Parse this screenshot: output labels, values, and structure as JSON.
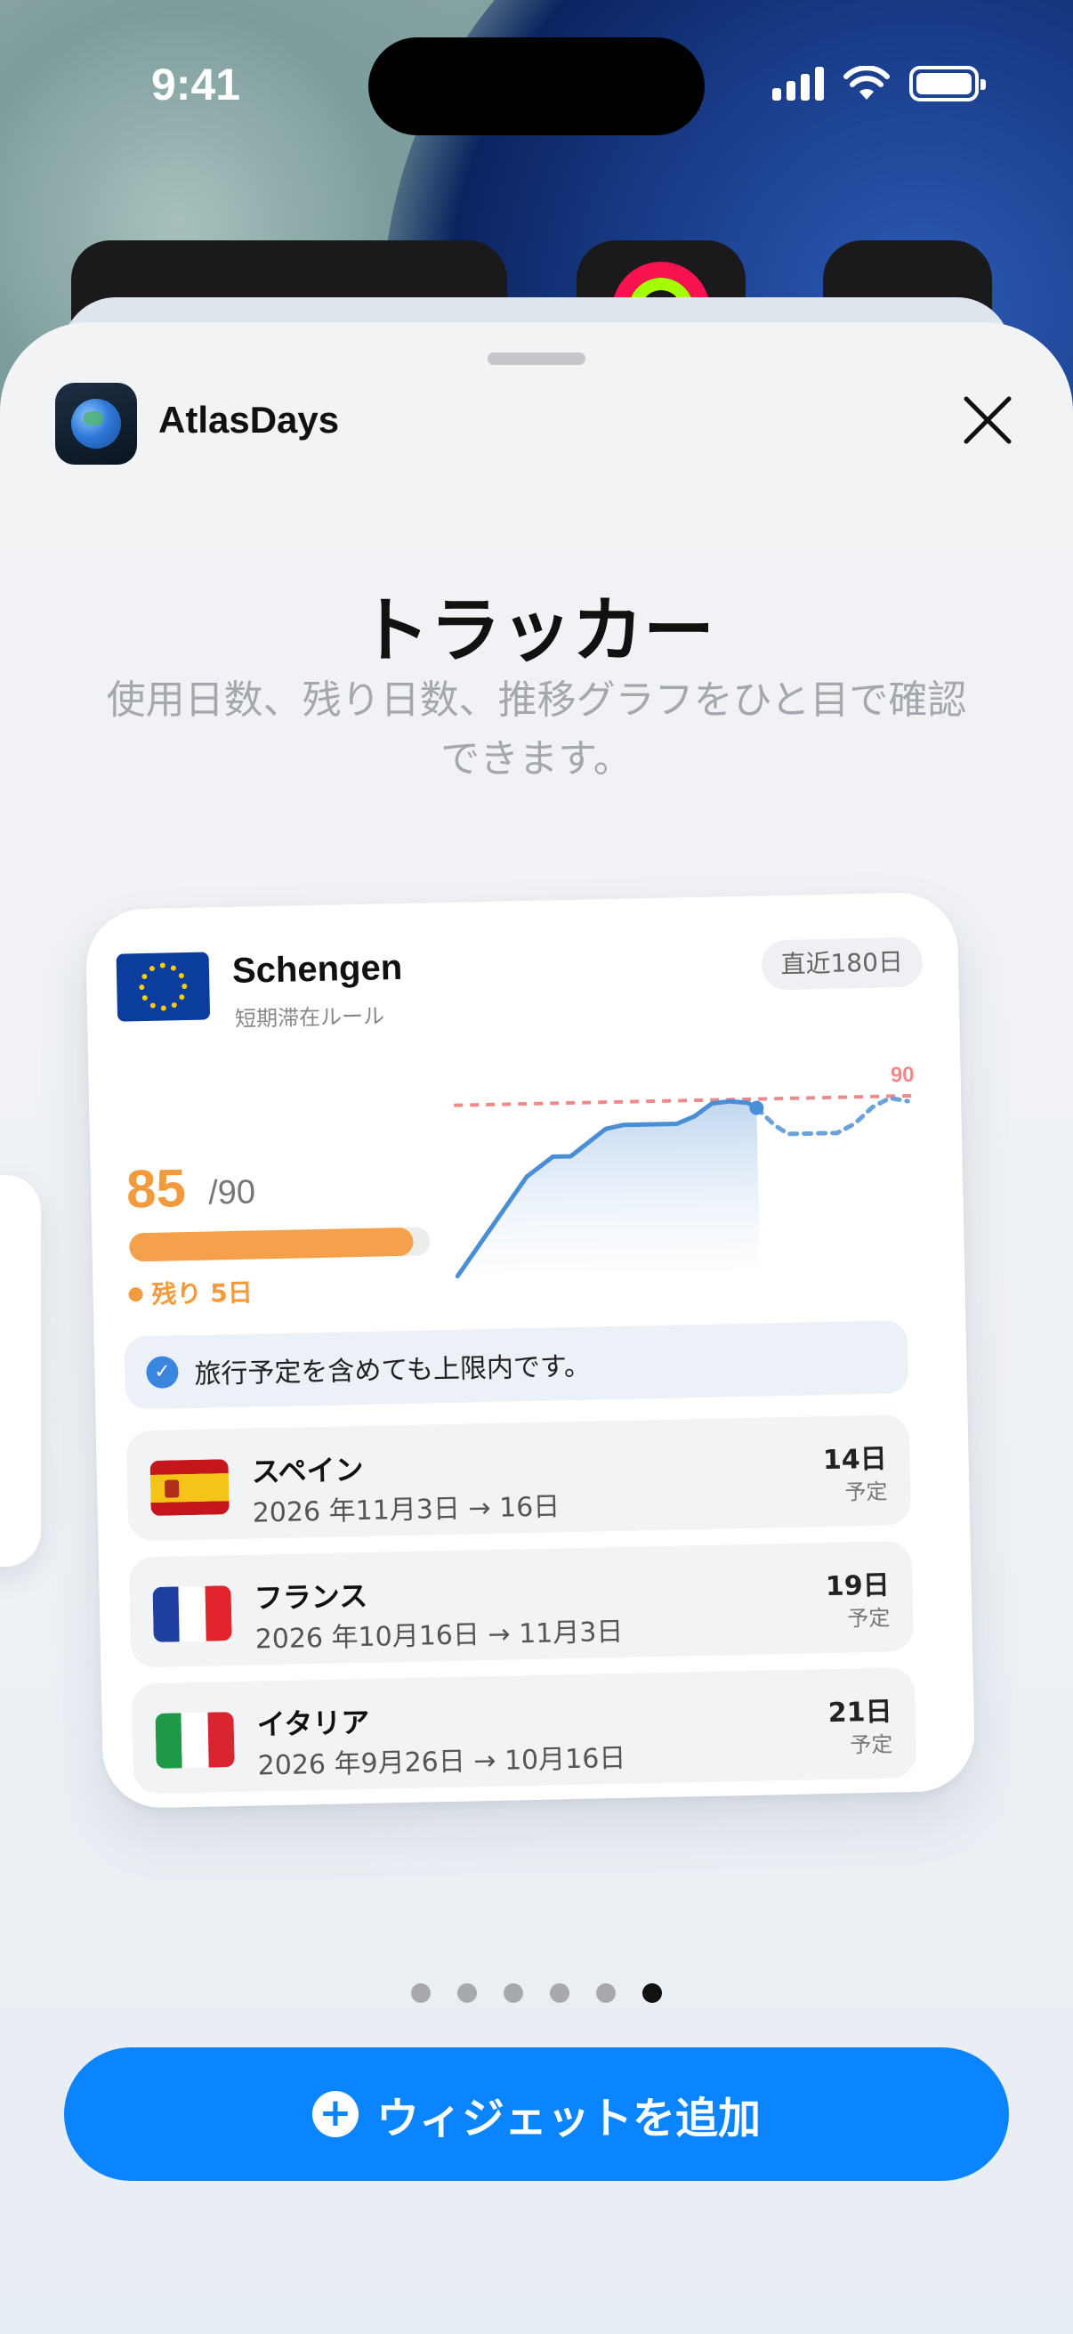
{
  "status_bar": {
    "time": "9:41"
  },
  "sheet": {
    "app_name": "AtlasDays",
    "title": "トラッカー",
    "subtitle": "使用日数、残り日数、推移グラフをひと目で確認できます。"
  },
  "widget": {
    "zone_name": "Schengen",
    "zone_rule": "短期滞在ルール",
    "window_label": "直近180日",
    "used_days": "85",
    "limit_label": "/90",
    "used_fraction": 0.944,
    "remaining": "残り 5日",
    "notice": "旅行予定を含めても上限内です。",
    "chart_limit_label": "90",
    "trips": [
      {
        "country": "スペイン",
        "dates": "2026 年11月3日 → 16日",
        "days": "14日",
        "kind": "予定",
        "flag": "spain-flag-icon"
      },
      {
        "country": "フランス",
        "dates": "2026 年10月16日 → 11月3日",
        "days": "19日",
        "kind": "予定",
        "flag": "france-flag-icon"
      },
      {
        "country": "イタリア",
        "dates": "2026 年9月26日 → 10月16日",
        "days": "21日",
        "kind": "予定",
        "flag": "italy-flag-icon"
      }
    ]
  },
  "pager": {
    "count": 6,
    "active_index": 5
  },
  "add_button": {
    "label": "ウィジェットを追加"
  },
  "colors": {
    "accent": "#0a84ff",
    "warning_orange": "#f19a3e",
    "limit_line": "#f08a8a",
    "chart_line": "#4a8fd6"
  }
}
